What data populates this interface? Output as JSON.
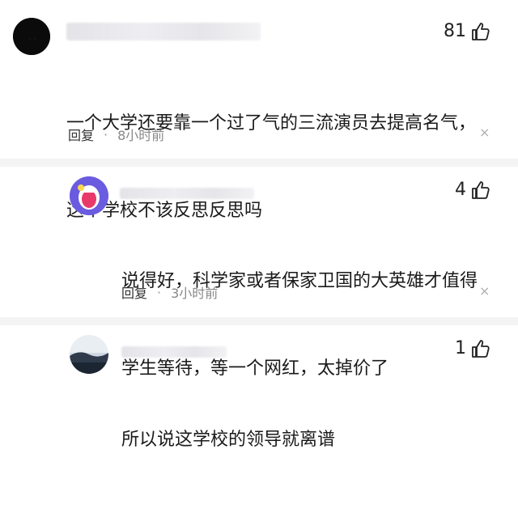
{
  "comments": [
    {
      "likes": "81",
      "text_line1": "一个大学还要靠一个过了气的三流演员去提高名气，",
      "text_line2": "这个学校不该反思反思吗",
      "reply_label": "回复",
      "separator": "·",
      "time": "8小时前",
      "close_glyph": "×"
    },
    {
      "likes": "4",
      "text_line1": "说得好，科学家或者保家卫国的大英雄才值得",
      "text_line2": "学生等待，等一个网红，太掉价了",
      "reply_label": "回复",
      "separator": "·",
      "time": "3小时前",
      "close_glyph": "×"
    },
    {
      "likes": "1",
      "text_line1": "所以说这学校的领导就离谱"
    }
  ]
}
